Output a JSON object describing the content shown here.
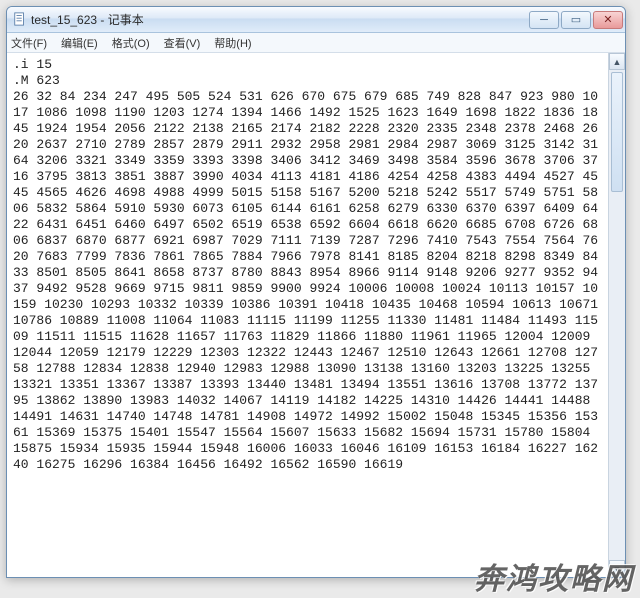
{
  "window": {
    "filename_in_title": "test_15_623",
    "app_name": "记事本",
    "title_sep": " - "
  },
  "menu": {
    "file": "文件(F)",
    "edit": "编辑(E)",
    "format": "格式(O)",
    "view": "查看(V)",
    "help": "帮助(H)"
  },
  "doc": {
    "i_line": ".i 15",
    "m_line": ".M 623",
    "numbers_block": "26 32 84 234 247 495 505 524 531 626 670 675 679 685 749 828 847 923 980 1017 1086 1098 1190 1203 1274 1394 1466 1492 1525 1623 1649 1698 1822 1836 1845 1924 1954 2056 2122 2138 2165 2174 2182 2228 2320 2335 2348 2378 2468 2620 2637 2710 2789 2857 2879 2911 2932 2958 2981 2984 2987 3069 3125 3142 3164 3206 3321 3349 3359 3393 3398 3406 3412 3469 3498 3584 3596 3678 3706 3716 3795 3813 3851 3887 3990 4034 4113 4181 4186 4254 4258 4383 4494 4527 4545 4565 4626 4698 4988 4999 5015 5158 5167 5200 5218 5242 5517 5749 5751 5806 5832 5864 5910 5930 6073 6105 6144 6161 6258 6279 6330 6370 6397 6409 6422 6431 6451 6460 6497 6502 6519 6538 6592 6604 6618 6620 6685 6708 6726 6806 6837 6870 6877 6921 6987 7029 7111 7139 7287 7296 7410 7543 7554 7564 7620 7683 7799 7836 7861 7865 7884 7966 7978 8141 8185 8204 8218 8298 8349 8433 8501 8505 8641 8658 8737 8780 8843 8954 8966 9114 9148 9206 9277 9352 9437 9492 9528 9669 9715 9811 9859 9900 9924 10006 10008 10024 10113 10157 10159 10230 10293 10332 10339 10386 10391 10418 10435 10468 10594 10613 10671 10786 10889 11008 11064 11083 11115 11199 11255 11330 11481 11484 11493 11509 11511 11515 11628 11657 11763 11829 11866 11880 11961 11965 12004 12009 12044 12059 12179 12229 12303 12322 12443 12467 12510 12643 12661 12708 12758 12788 12834 12838 12940 12983 12988 13090 13138 13160 13203 13225 13255 13321 13351 13367 13387 13393 13440 13481 13494 13551 13616 13708 13772 13795 13862 13890 13983 14032 14067 14119 14182 14225 14310 14426 14441 14488 14491 14631 14740 14748 14781 14908 14972 14992 15002 15048 15345 15356 15361 15369 15375 15401 15547 15564 15607 15633 15682 15694 15731 15780 15804 15875 15934 15935 15944 15948 16006 16033 16046 16109 16153 16184 16227 16240 16275 16296 16384 16456 16492 16562 16590 16619"
  },
  "watermark": {
    "main": "奔鸿攻略网",
    "sub": ""
  }
}
